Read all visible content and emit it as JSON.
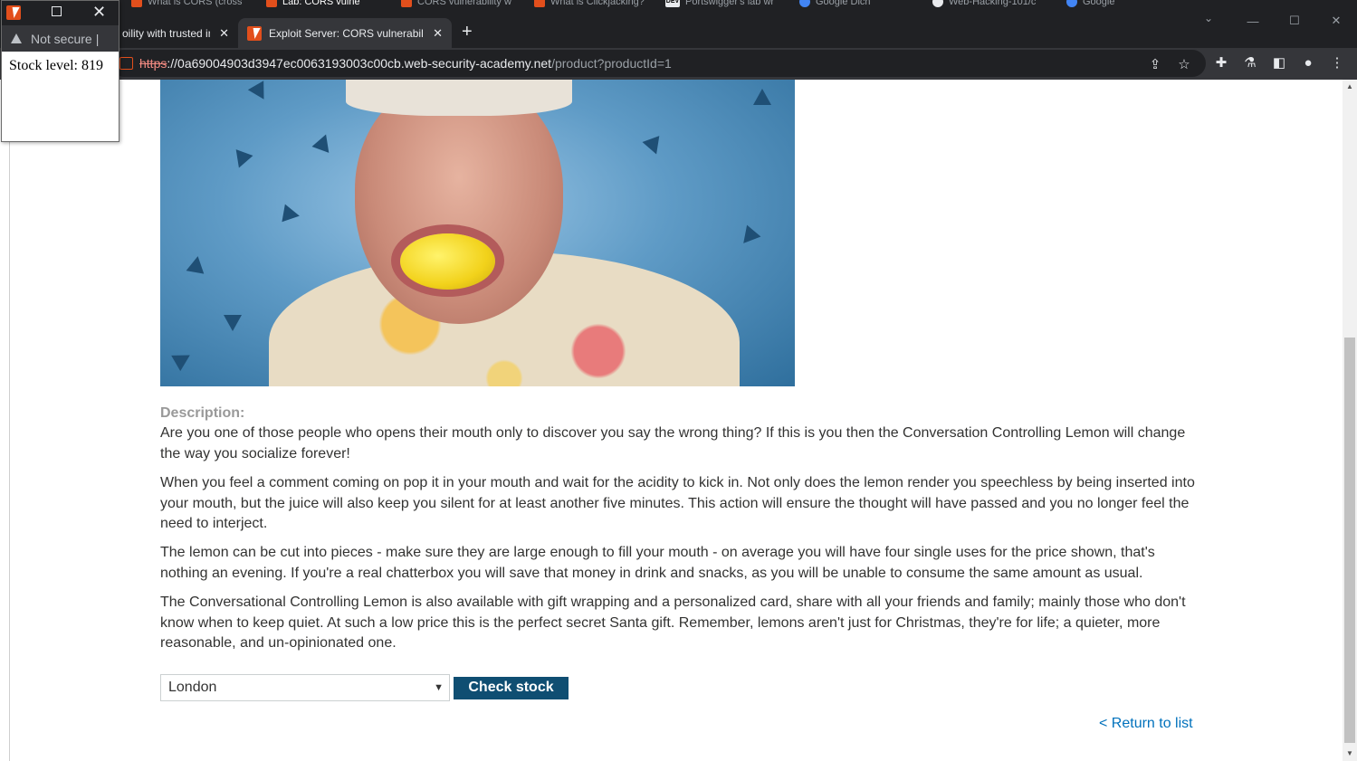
{
  "back_tabs": [
    {
      "label": "What is CORS (cross",
      "icon": "burp-icon"
    },
    {
      "label": "Lab: CORS vulne",
      "icon": "burp-icon"
    },
    {
      "label": "CORS vulnerability w",
      "icon": "burp-icon"
    },
    {
      "label": "What is Clickjacking?",
      "icon": "burp-icon"
    },
    {
      "label": "Portswigger's lab wr",
      "icon": "dev-icon"
    },
    {
      "label": "Google Dich",
      "icon": "google-translate-icon"
    },
    {
      "label": "Web-Hacking-101/c",
      "icon": "github-icon"
    },
    {
      "label": "Google",
      "icon": "google-icon"
    }
  ],
  "browser": {
    "tabs": [
      {
        "label": "oility with trusted in"
      },
      {
        "label": "Exploit Server: CORS vulnerability"
      }
    ],
    "url": {
      "scheme": "https",
      "host": "://0a69004903d3947ec0063193003c00cb.web-security-academy.net",
      "path": "/product?productId=1"
    }
  },
  "popup": {
    "url_text": "Not secure",
    "content": "Stock level: 819"
  },
  "product": {
    "description_heading": "Description:",
    "paragraphs": [
      "Are you one of those people who opens their mouth only to discover you say the wrong thing? If this is you then the Conversation Controlling Lemon will change the way you socialize forever!",
      "When you feel a comment coming on pop it in your mouth and wait for the acidity to kick in. Not only does the lemon render you speechless by being inserted into your mouth, but the juice will also keep you silent for at least another five minutes. This action will ensure the thought will have passed and you no longer feel the need to interject.",
      "The lemon can be cut into pieces - make sure they are large enough to fill your mouth - on average you will have four single uses for the price shown, that's nothing an evening. If you're a real chatterbox you will save that money in drink and snacks, as you will be unable to consume the same amount as usual.",
      "The Conversational Controlling Lemon is also available with gift wrapping and a personalized card, share with all your friends and family; mainly those who don't know when to keep quiet. At such a low price this is the perfect secret Santa gift. Remember, lemons aren't just for Christmas, they're for life; a quieter, more reasonable, and un-opinionated one."
    ],
    "store_select": {
      "selected": "London"
    },
    "check_stock_label": "Check stock",
    "return_link": "< Return to list"
  },
  "colors": {
    "brand_orange": "#e24f1c",
    "button_blue": "#0f4e72",
    "link_blue": "#0071bc"
  }
}
